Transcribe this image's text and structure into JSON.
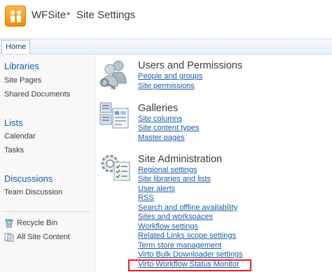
{
  "header": {
    "site_title": "WFSite",
    "separator": "▸",
    "page_title": "Site Settings"
  },
  "topnav": {
    "home_tab": "Home"
  },
  "leftnav": {
    "libraries": {
      "heading": "Libraries",
      "items": [
        "Site Pages",
        "Shared Documents"
      ]
    },
    "lists": {
      "heading": "Lists",
      "items": [
        "Calendar",
        "Tasks"
      ]
    },
    "discussions": {
      "heading": "Discussions",
      "items": [
        "Team Discussion"
      ]
    },
    "recycle_bin": "Recycle Bin",
    "all_site_content": "All Site Content"
  },
  "sections": {
    "users": {
      "title": "Users and Permissions",
      "links": [
        "People and groups",
        "Site permissions"
      ]
    },
    "galleries": {
      "title": "Galleries",
      "links": [
        "Site columns",
        "Site content types",
        "Master pages"
      ]
    },
    "admin": {
      "title": "Site Administration",
      "links": [
        "Regional settings",
        "Site libraries and lists",
        "User alerts",
        "RSS",
        "Search and offline availability",
        "Sites and workspaces",
        "Workflow settings",
        "Related Links scope settings",
        "Term store management",
        "Virto Bulk Downloader settings",
        "Virto Workflow Status Monitor"
      ]
    }
  },
  "colors": {
    "link": "#1b5c9e",
    "highlight": "#e8202c",
    "accent": "#f08f0c"
  }
}
